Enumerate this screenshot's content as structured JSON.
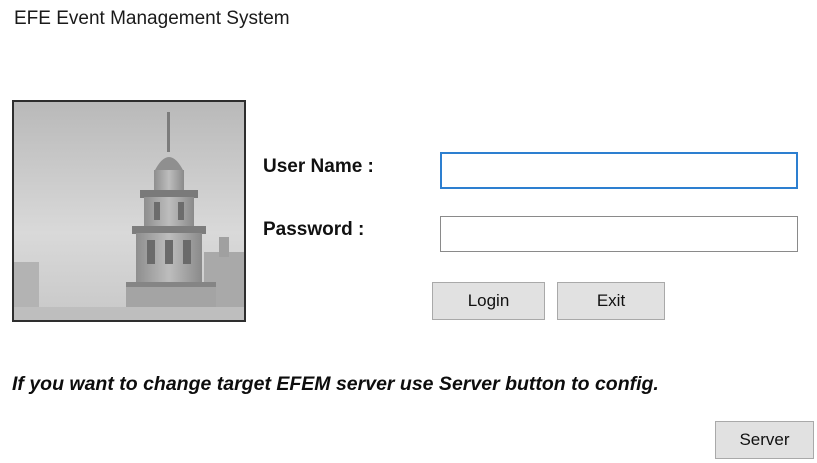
{
  "app": {
    "title": "EFE Event Management System"
  },
  "login": {
    "username_label": "User Name :",
    "username_value": "",
    "password_label": "Password :",
    "password_value": "",
    "login_label": "Login",
    "exit_label": "Exit"
  },
  "info": {
    "hint_text": "If you want to change target EFEM server use Server button to config.",
    "server_label": "Server"
  },
  "image": {
    "subject": "maiden-tower-photo"
  },
  "colors": {
    "focus_border": "#2d7fd0",
    "button_bg": "#e1e1e1",
    "text": "#111111"
  }
}
